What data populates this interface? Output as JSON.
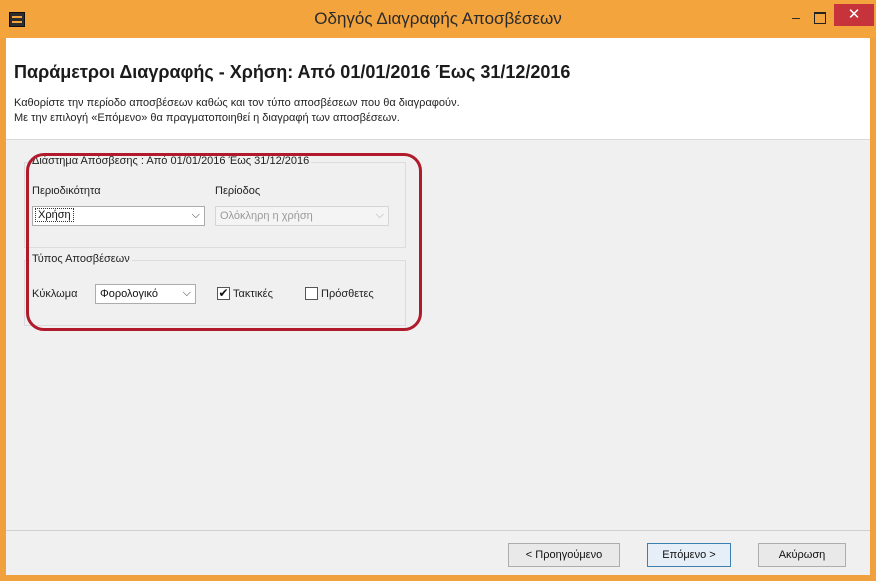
{
  "window": {
    "title": "Οδηγός Διαγραφής Αποσβέσεων",
    "minimize_label": "–",
    "close_label": "✕"
  },
  "header": {
    "title": "Παράμετροι Διαγραφής - Χρήση: Από 01/01/2016 Έως 31/12/2016",
    "line1": "Καθορίστε την περίοδο αποσβέσεων καθώς και τον τύπο αποσβέσεων που θα διαγραφούν.",
    "line2": "Με την επιλογή «Επόμενο» θα πραγματοποιηθεί η διαγραφή των αποσβέσεων."
  },
  "interval_group": {
    "label": "Διάστημα Απόσβεσης : Από 01/01/2016 Έως 31/12/2016",
    "periodicity_label": "Περιοδικότητα",
    "periodicity_value": "Χρήση",
    "period_label": "Περίοδος",
    "period_value": "Ολόκληρη η χρήση"
  },
  "types_group": {
    "label": "Τύπος Αποσβέσεων",
    "cycle_label": "Κύκλωμα",
    "cycle_value": "Φορολογικό",
    "regular_label": "Τακτικές",
    "regular_checked": true,
    "additional_label": "Πρόσθετες",
    "additional_checked": false
  },
  "footer": {
    "back_label": "< Προηγούμενο",
    "next_label": "Επόμενο >",
    "cancel_label": "Ακύρωση"
  },
  "icons": {
    "dropdown_arrow": "chevron-down-icon",
    "check_mark": "check-icon"
  },
  "colors": {
    "titlebar": "#f3a43d",
    "close_button": "#c7333a",
    "highlight_ring": "#b01a2a"
  }
}
